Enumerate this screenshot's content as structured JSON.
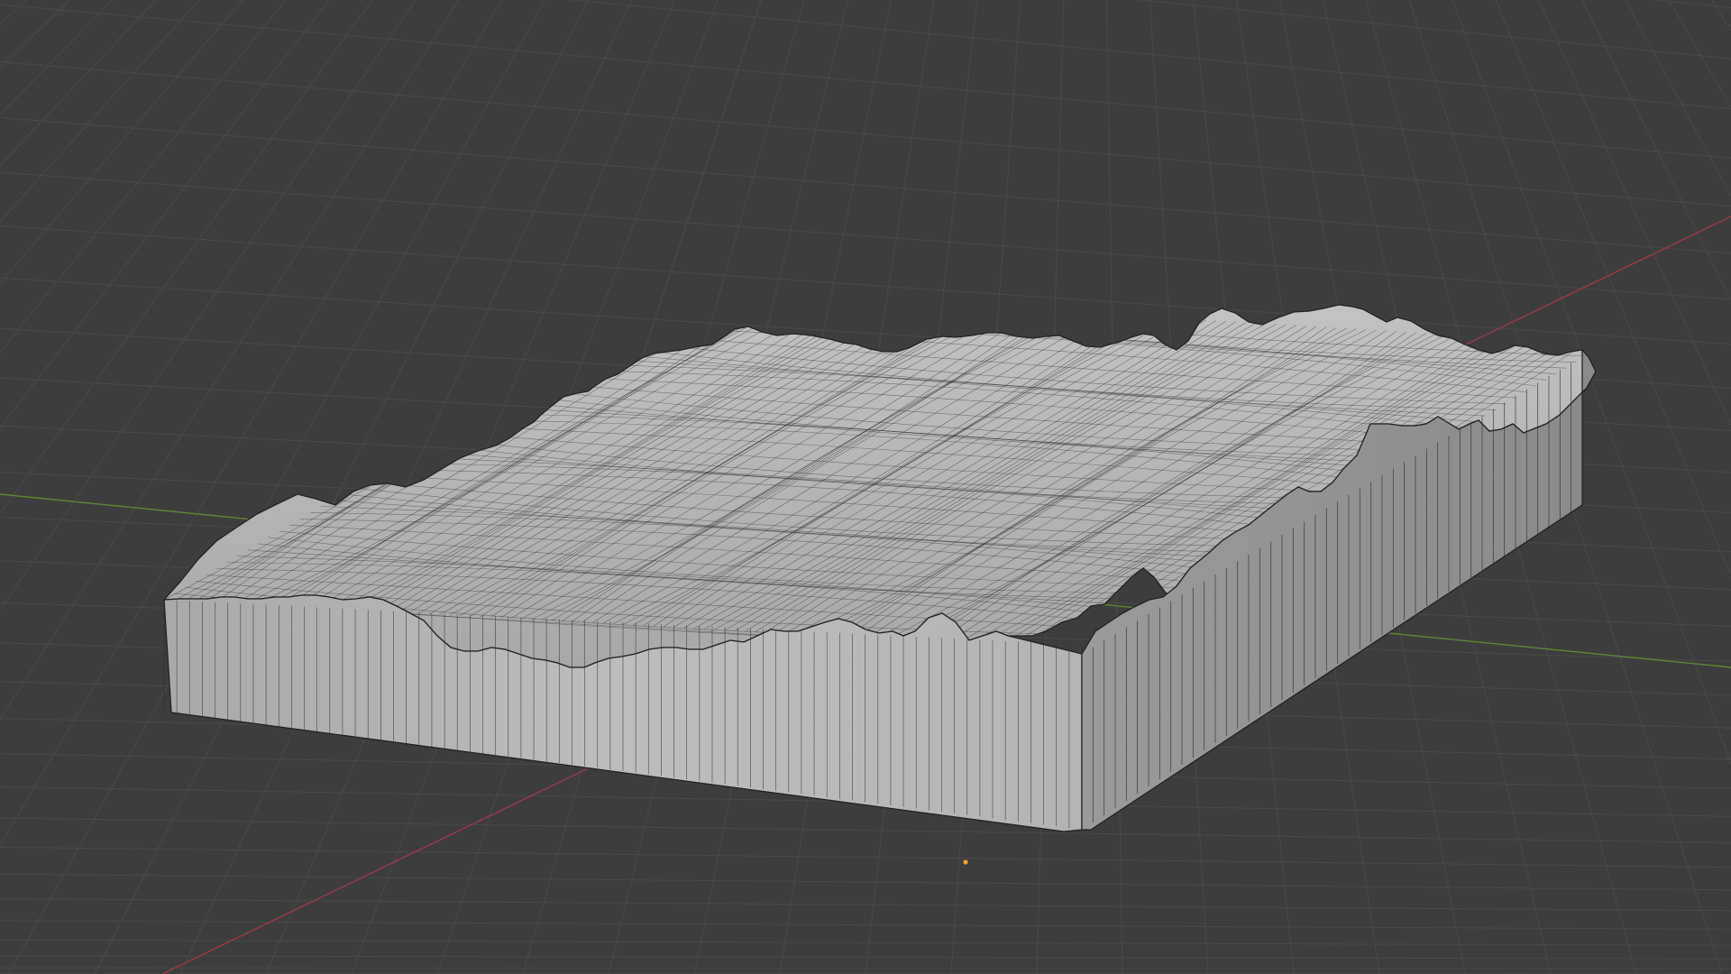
{
  "viewport": {
    "background_color": "#3d3d3d",
    "grid_line_color": "#4a4a4a",
    "x_axis_color": "#9b3b44",
    "y_axis_color": "#5b8a2e",
    "mesh_face_color": "#b3b3b3",
    "mesh_wire_color": "#2a2a2a",
    "origin_marker_color": "#f0a020"
  },
  "object": {
    "type": "terrain-mesh",
    "shading": "solid-with-wireframe"
  }
}
